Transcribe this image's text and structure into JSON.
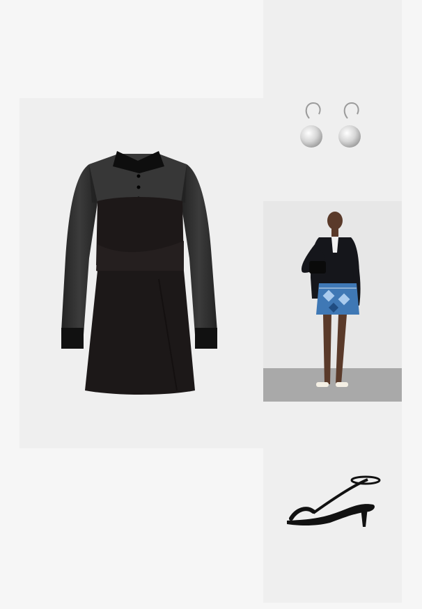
{
  "outfit": {
    "items": [
      {
        "id": "dress",
        "icon": "dress-image",
        "description_hidden": ""
      },
      {
        "id": "earring",
        "icon": "earring-image"
      },
      {
        "id": "model",
        "icon": "model-image"
      },
      {
        "id": "sandal",
        "icon": "sandal-image"
      }
    ],
    "colors": {
      "page_background": "#f6f6f6",
      "tile_background": "#efefef",
      "dress": "#1c1818",
      "sheer": "#2a2a2a",
      "denim_blue": "#3f78b5",
      "sandal": "#1a1a1a",
      "pearl": "#dcdcdc"
    }
  }
}
